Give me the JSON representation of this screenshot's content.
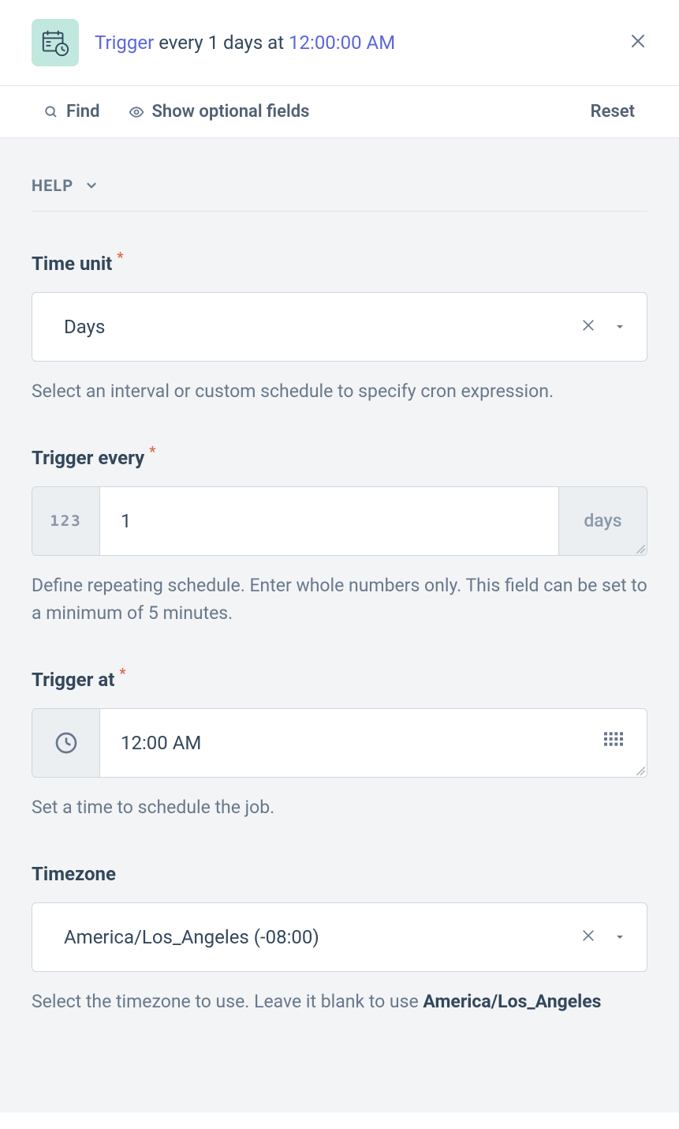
{
  "header": {
    "title_prefix": "Trigger",
    "title_middle": "every 1 days at",
    "title_time": "12:00:00 AM"
  },
  "toolbar": {
    "find_label": "Find",
    "optional_label": "Show optional fields",
    "reset_label": "Reset"
  },
  "help_section": {
    "label": "HELP"
  },
  "fields": {
    "time_unit": {
      "label": "Time unit",
      "value": "Days",
      "help": "Select an interval or custom schedule to specify cron expression."
    },
    "trigger_every": {
      "label": "Trigger every",
      "value": "1",
      "suffix": "days",
      "prefix_digits": "123",
      "help": "Define repeating schedule. Enter whole numbers only. This field can be set to a minimum of 5 minutes."
    },
    "trigger_at": {
      "label": "Trigger at",
      "value": "12:00 AM",
      "help": "Set a time to schedule the job."
    },
    "timezone": {
      "label": "Timezone",
      "value": "America/Los_Angeles (-08:00)",
      "help_prefix": "Select the timezone to use. Leave it blank to use ",
      "help_strong": "America/Los_Angeles"
    }
  }
}
